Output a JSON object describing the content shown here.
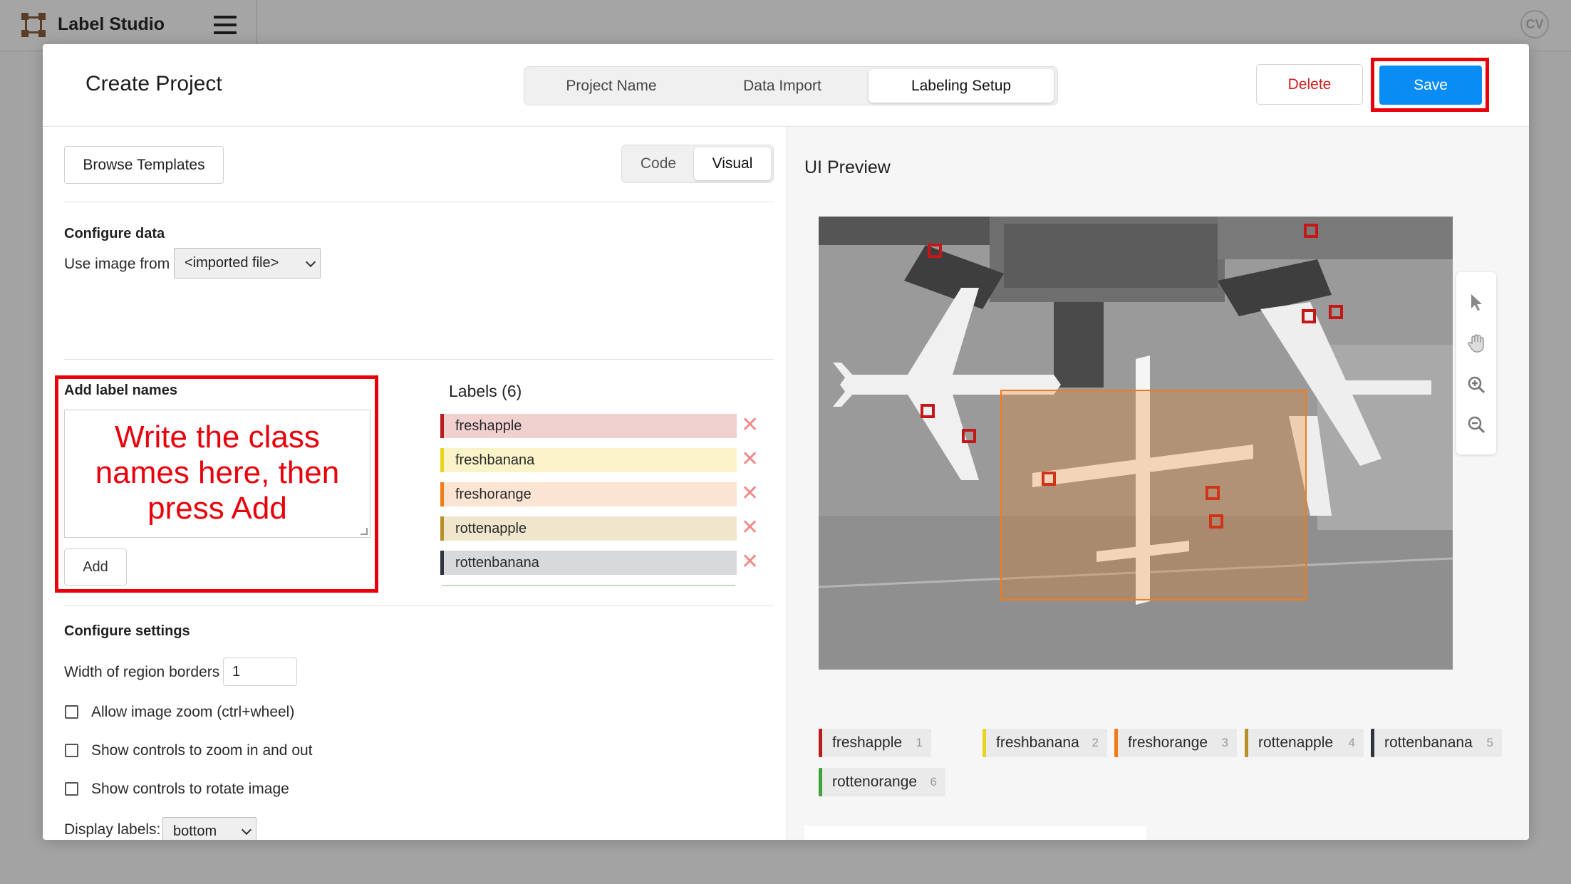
{
  "app": {
    "title": "Label Studio",
    "avatar_initials": "CV"
  },
  "modal": {
    "title": "Create Project",
    "steps": [
      "Project Name",
      "Data Import",
      "Labeling Setup"
    ],
    "active_step": "Labeling Setup",
    "delete_label": "Delete",
    "save_label": "Save"
  },
  "config": {
    "browse_templates": "Browse Templates",
    "modes": [
      "Code",
      "Visual"
    ],
    "active_mode": "Visual",
    "configure_data_title": "Configure data",
    "use_image_from_label": "Use image from",
    "image_source_value": "<imported file>",
    "add_label_names_title": "Add label names",
    "annotation_text": "Write the class names here, then press Add",
    "add_button": "Add",
    "labels_title": "Labels (6)",
    "labels": [
      {
        "name": "freshapple",
        "color": "#b91c1c",
        "bg": "#f1d0d0"
      },
      {
        "name": "freshbanana",
        "color": "#e8d41f",
        "bg": "#faf3c8"
      },
      {
        "name": "freshorange",
        "color": "#f07c1a",
        "bg": "#fbe4d2"
      },
      {
        "name": "rottenapple",
        "color": "#b8902a",
        "bg": "#efe6cc"
      },
      {
        "name": "rottenbanana",
        "color": "#2f3440",
        "bg": "#d8d9db"
      }
    ],
    "configure_settings_title": "Configure settings",
    "width_of_region_borders_label": "Width of region borders",
    "width_of_region_borders_value": "1",
    "checkboxes": [
      "Allow image zoom (ctrl+wheel)",
      "Show controls to zoom in and out",
      "Show controls to rotate image"
    ],
    "display_labels_label": "Display labels:",
    "display_labels_value": "bottom"
  },
  "preview": {
    "title": "UI Preview",
    "chips": [
      {
        "name": "freshapple",
        "hotkey": "1",
        "color": "#b91c1c"
      },
      {
        "name": "freshbanana",
        "hotkey": "2",
        "color": "#e8d41f"
      },
      {
        "name": "freshorange",
        "hotkey": "3",
        "color": "#f07c1a"
      },
      {
        "name": "rottenapple",
        "hotkey": "4",
        "color": "#b8902a"
      },
      {
        "name": "rottenbanana",
        "hotkey": "5",
        "color": "#2f3440"
      },
      {
        "name": "rottenorange",
        "hotkey": "6",
        "color": "#3fa33a"
      }
    ],
    "tools": [
      "pointer-icon",
      "hand-icon",
      "zoom-in-icon",
      "zoom-out-icon"
    ],
    "bbox_color": "#f07c1a"
  }
}
